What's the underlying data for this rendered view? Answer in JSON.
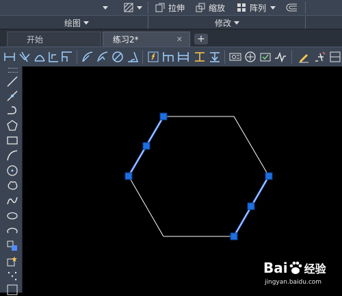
{
  "ribbon": {
    "stretch_label": "拉伸",
    "scale_label": "缩放",
    "array_label": "阵列",
    "draw_panel_title": "绘图",
    "modify_panel_title": "修改"
  },
  "tabs": {
    "start_label": "开始",
    "drawing_label": "练习2*",
    "close_glyph": "✕",
    "add_glyph": "+"
  },
  "toolbar_icons": [
    "linear-dimension-icon",
    "aligned-dimension-icon",
    "arc-length-icon",
    "ordinate-dimension-icon",
    "radius-dimension-icon",
    "jogged-dimension-icon",
    "diameter-dimension-icon",
    "angular-dimension-icon",
    "quick-dimension-icon",
    "baseline-dimension-icon",
    "continue-dimension-icon",
    "dimension-space-icon",
    "dimension-break-icon",
    "tolerance-icon",
    "center-mark-icon",
    "inspection-icon",
    "jogged-linear-icon",
    "dimension-edit-icon",
    "dimension-text-edit-icon",
    "dimension-update-icon"
  ],
  "left_tools": [
    "line-icon",
    "construction-line-icon",
    "polyline-icon",
    "polygon-icon",
    "rectangle-icon",
    "arc-icon",
    "circle-icon",
    "revision-cloud-icon",
    "spline-icon",
    "ellipse-icon",
    "ellipse-arc-icon",
    "insert-block-icon",
    "make-block-icon",
    "point-icon",
    "hatch-icon"
  ],
  "drawing": {
    "shape": "hexagon",
    "line_color": "#ffffff",
    "selected_color": "#4f8cff",
    "grip_color": "#1e6fe0"
  },
  "watermark": {
    "logo_text_a": "Bai",
    "logo_text_b": "经验",
    "url": "jingyan.baidu.com"
  }
}
